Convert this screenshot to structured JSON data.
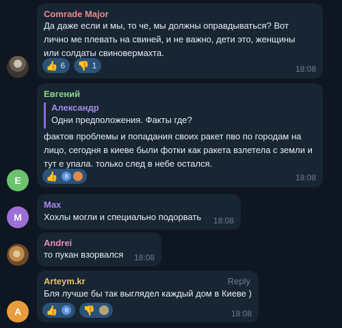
{
  "messages": [
    {
      "author": "Comrade Major",
      "author_color": "#e88b8b",
      "text_lines": [
        "Да даже если и мы, то че, мы должны оправдываться? Вот",
        "лично ме плевать на свиней, и не важно, дети это, женщины",
        "или солдаты свиновермахта."
      ],
      "reactions": [
        {
          "emoji": "👍",
          "count": "6"
        },
        {
          "emoji": "👎",
          "count": "1"
        }
      ],
      "time": "18:08",
      "avatar_icon": "profile-photo"
    },
    {
      "author": "Евгений",
      "author_color": "#8ad68a",
      "quote_author": "Александр",
      "quote_text": "Одни предположения. Факты где?",
      "text_lines": [
        "фактов проблемы и попадания своих ракет пво по городам на",
        "лицо, сегодня в киеве были фотки как ракета взлетела с земли и",
        "тут е упала. только след в небе остался."
      ],
      "reaction_emoji": "👍",
      "reactor_initial": "B",
      "time": "18:08",
      "avatar_letter": "E",
      "avatar_color": "#6cc36c"
    },
    {
      "author": "Max",
      "author_color": "#a68bea",
      "text": "Хохлы могли и специально подорвать",
      "time": "18:08",
      "avatar_letter": "M",
      "avatar_color": "#9c6fd6"
    },
    {
      "author": "Andrei",
      "author_color": "#e88bb5",
      "text": "то пукан взорвался",
      "time": "18:08",
      "avatar_icon": "profile-photo"
    },
    {
      "author": "Arteym.kr",
      "author_color": "#e8c06a",
      "reply_label": "Reply",
      "text": "Бля лучше бы так выглядел каждый дом в Киеве )",
      "reaction_like": "👍",
      "reaction_dislike": "👎",
      "reactor_initial": "B",
      "time": "18:08",
      "avatar_letter": "A",
      "avatar_color": "#e99c3b"
    }
  ]
}
